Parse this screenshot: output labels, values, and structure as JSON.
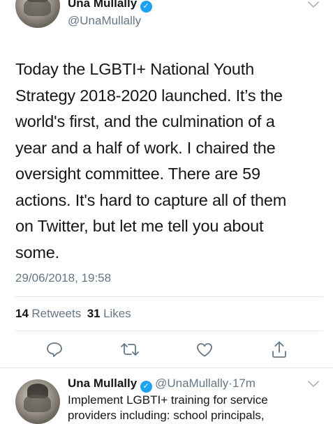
{
  "tweet": {
    "author_name": "Una Mullally",
    "author_handle": "@UnaMullally",
    "text_lines": [
      "Today the LGBTI+ National Youth",
      "Strategy 2018-2020 launched. It’s the",
      "world's first, and the culmination of a",
      "year and a half of work. I chaired the",
      "oversight committee. There are 59",
      "actions. It's hard to capture all of them",
      "on Twitter, but let me tell you about",
      "some."
    ],
    "timestamp": "29/06/2018, 19:58",
    "stats": {
      "retweets_count": "14",
      "retweets_label": "Retweets",
      "likes_count": "31",
      "likes_label": "Likes"
    }
  },
  "icons": {
    "verified": "verified-badge-icon",
    "menu": "chevron-down-icon",
    "reply": "reply-icon",
    "retweet": "retweet-icon",
    "like": "heart-icon",
    "share": "share-icon"
  },
  "reply_tweet": {
    "author_name": "Una Mullally",
    "author_handle": "@UnaMullally",
    "separator": "·",
    "time_ago": "17m",
    "text_lines": [
      "Implement LGBTI+ training for service",
      "providers including: school principals,"
    ]
  },
  "colors": {
    "accent": "#1da1f2",
    "text": "#14171a",
    "secondary": "#657786",
    "divider": "#e1e8ed"
  }
}
